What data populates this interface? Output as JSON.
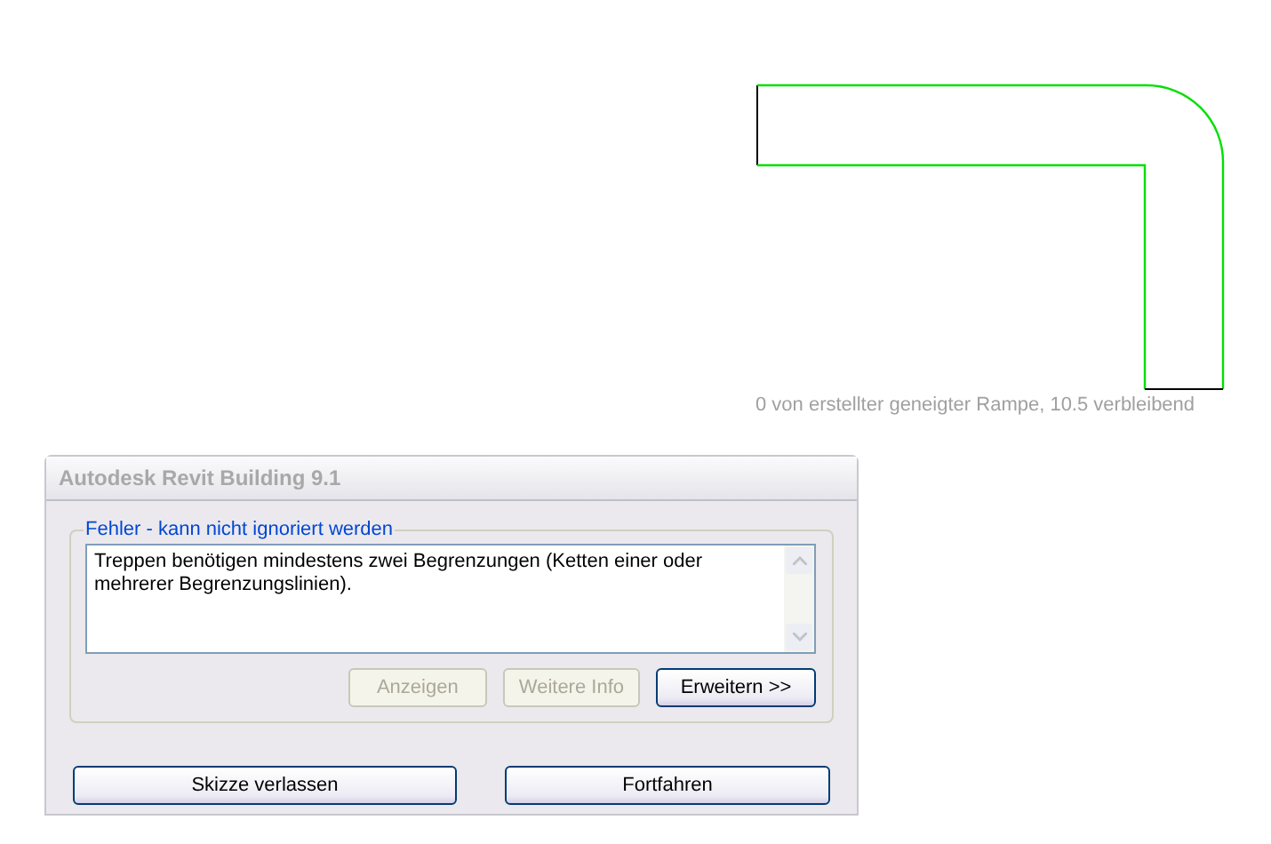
{
  "sketch": {
    "status": "0 von erstellter geneigter Rampe, 10.5 verbleibend"
  },
  "dialog": {
    "title": "Autodesk Revit Building 9.1",
    "group": {
      "legend": "Fehler - kann nicht ignoriert werden",
      "message": "Treppen benötigen mindestens zwei Begrenzungen (Ketten einer oder mehrerer Begrenzungslinien).",
      "buttons": [
        {
          "label": "Anzeigen",
          "disabled": true
        },
        {
          "label": "Weitere Info",
          "disabled": true
        },
        {
          "label": "Erweitern >>",
          "disabled": false
        }
      ]
    },
    "actions": [
      {
        "label": "Skizze verlassen"
      },
      {
        "label": "Fortfahren"
      }
    ]
  }
}
